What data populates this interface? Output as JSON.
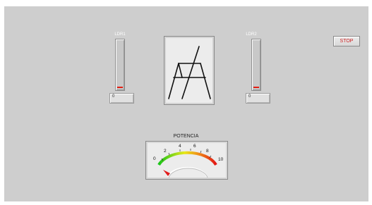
{
  "ldr1": {
    "label": "LDR1",
    "value": "0",
    "level": 0
  },
  "ldr2": {
    "label": "LDR2",
    "value": "0",
    "level": 0
  },
  "stop_button": {
    "label": "STOP"
  },
  "gauge": {
    "title": "POTENCIA",
    "scale_labels": [
      "0",
      "2",
      "4",
      "6",
      "8",
      "10"
    ],
    "min": 0,
    "max": 10,
    "value": 0
  },
  "colors": {
    "panel": "#cecece",
    "stop_text": "#cc1f1f",
    "tank_fill": "#e41e12",
    "label": "#ffffff"
  }
}
